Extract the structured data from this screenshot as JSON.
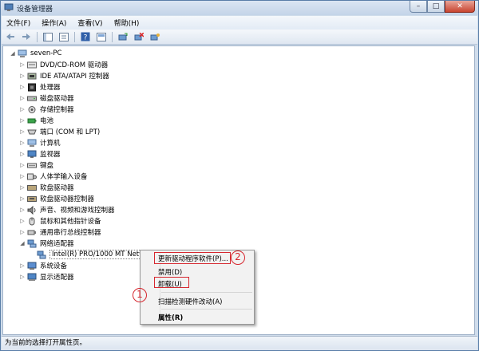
{
  "window": {
    "title": "设备管理器",
    "minimize": "–",
    "maximize": "□",
    "close": "✕"
  },
  "menu": [
    "文件(F)",
    "操作(A)",
    "查看(V)",
    "帮助(H)"
  ],
  "toolbar_icons": [
    "back-icon",
    "forward-icon",
    "console-tree-icon",
    "properties-icon",
    "help-icon",
    "view-icon",
    "update-driver-icon",
    "uninstall-icon",
    "scan-hardware-icon"
  ],
  "tree": {
    "root": "seven-PC",
    "items": [
      "DVD/CD-ROM 驱动器",
      "IDE ATA/ATAPI 控制器",
      "处理器",
      "磁盘驱动器",
      "存储控制器",
      "电池",
      "端口 (COM 和 LPT)",
      "计算机",
      "监视器",
      "键盘",
      "人体学输入设备",
      "软盘驱动器",
      "软盘驱动器控制器",
      "声音、视频和游戏控制器",
      "鼠标和其他指针设备",
      "通用串行总线控制器",
      "网络适配器",
      "Intel(R) PRO/1000 MT Network Connection",
      "系统设备",
      "显示适配器"
    ]
  },
  "context_menu": {
    "update": "更新驱动程序软件(P)...",
    "disable": "禁用(D)",
    "uninstall": "卸载(U)",
    "scan": "扫描检测硬件改动(A)",
    "properties": "属性(R)"
  },
  "annotations": {
    "one": "1",
    "two": "2"
  },
  "status": "为当前的选择打开属性页。",
  "colors": {
    "annotation": "#d6272f",
    "selection": "#ffffff",
    "accent": "#5a7ea8"
  }
}
